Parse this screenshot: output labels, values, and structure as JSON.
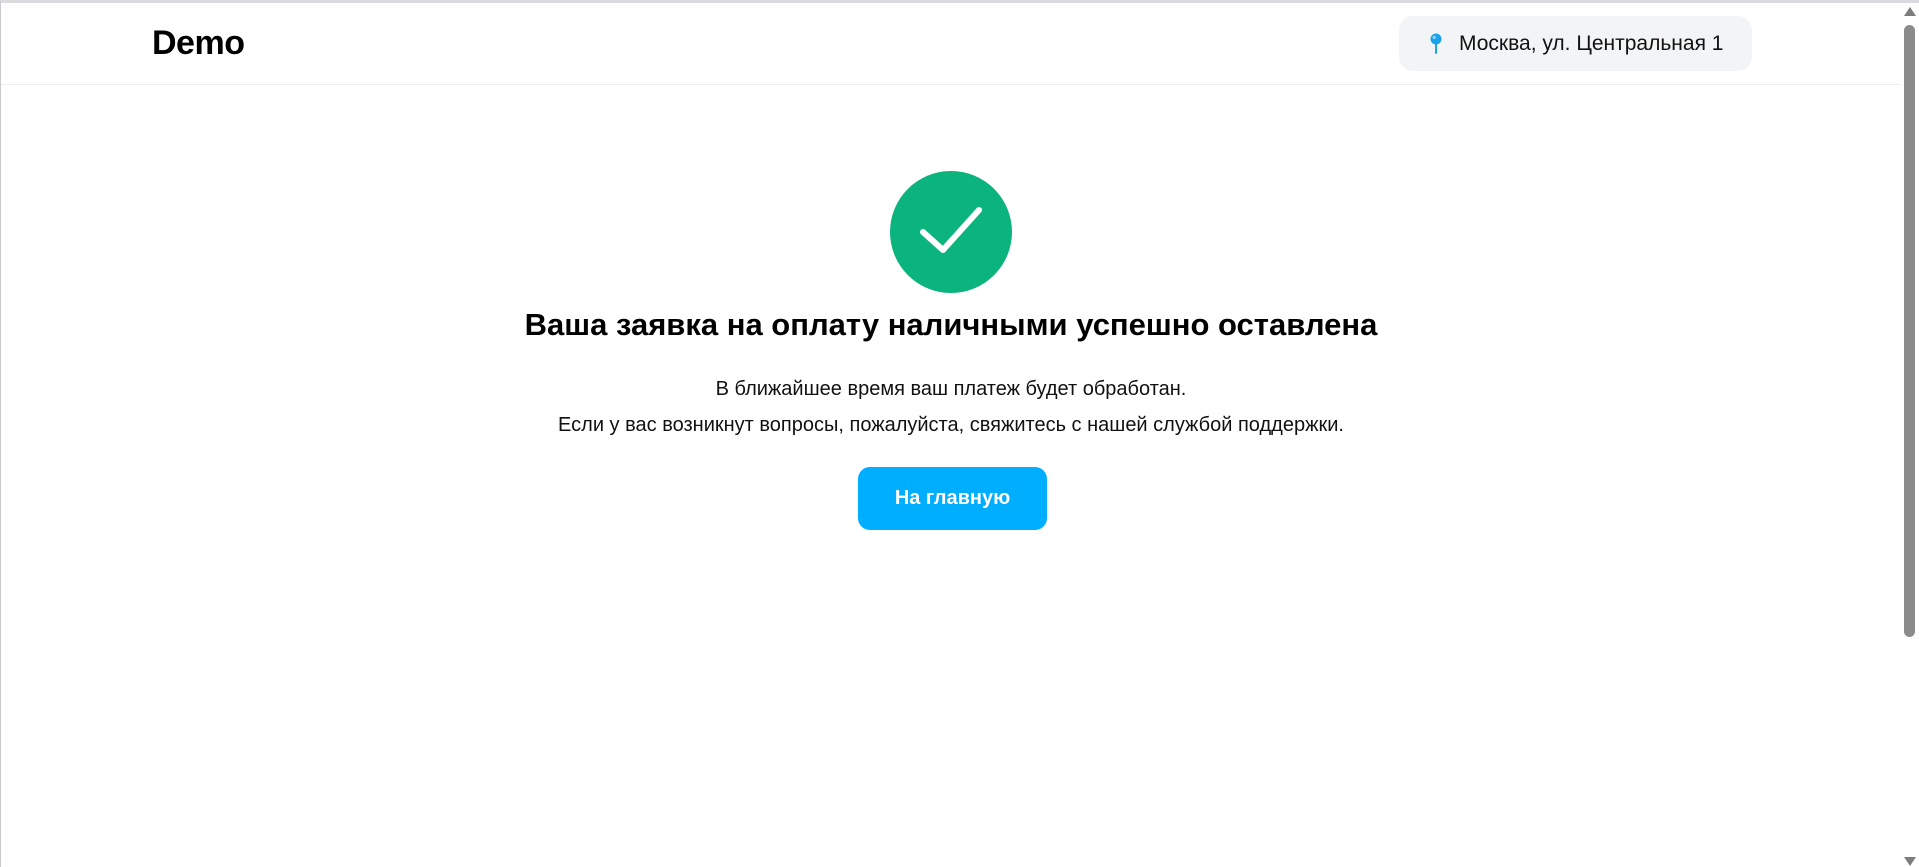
{
  "header": {
    "logo": "Demo",
    "address": {
      "icon": "map-pin-icon",
      "text": "Москва, ул. Центральная 1"
    }
  },
  "main": {
    "status_icon": "checkmark-circle-icon",
    "title": "Ваша заявка на оплату наличными успешно оставлена",
    "description_line_1": "В ближайшее время ваш платеж будет обработан.",
    "description_line_2": "Если у вас возникнут вопросы, пожалуйста, свяжитесь с нашей службой поддержки.",
    "home_button_label": "На главную"
  },
  "colors": {
    "success": "#0bb47c",
    "primary_button": "#00aeff",
    "pin": "#1aa3e8",
    "address_bg": "#f2f4f6"
  }
}
